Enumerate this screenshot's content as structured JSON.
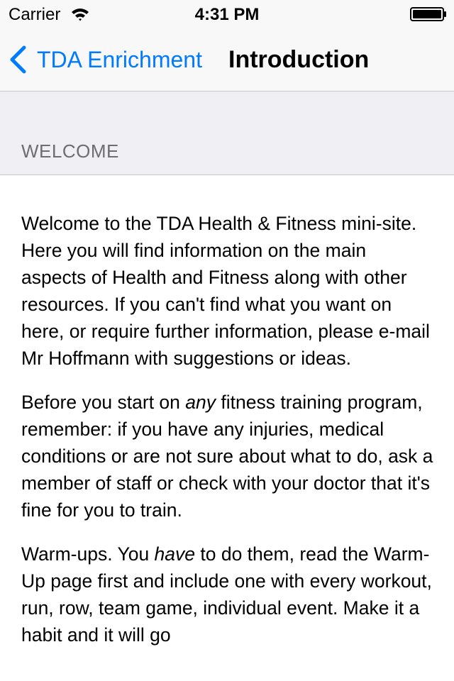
{
  "status_bar": {
    "carrier": "Carrier",
    "time": "4:31 PM",
    "icons": [
      "wifi-icon",
      "battery-icon"
    ]
  },
  "nav_bar": {
    "back_label": "TDA Enrichment",
    "back_icon": "chevron-left-icon",
    "title": "Introduction",
    "accent_color": "#007aff"
  },
  "section": {
    "header": "WELCOME",
    "paragraphs": [
      {
        "text": "Welcome to the TDA Health & Fitness mini-site. Here you will find information on the main aspects of Health and Fitness along with other resources. If you can't find what you want on here, or require further information, please e-mail Mr Hoffmann with suggestions or ideas."
      },
      {
        "before": "Before you start on ",
        "emphasis": "any",
        "after": " fitness training program, remember: if you have any injuries, medical conditions or are not sure about what to do, ask a member of staff or check with your doctor that it's fine for you to train."
      },
      {
        "before": "Warm-ups. You ",
        "emphasis": "have",
        "after": " to do them, read the Warm-Up page first and include one with every workout, run, row, team game, individual event. Make it a habit and it will go"
      }
    ]
  }
}
